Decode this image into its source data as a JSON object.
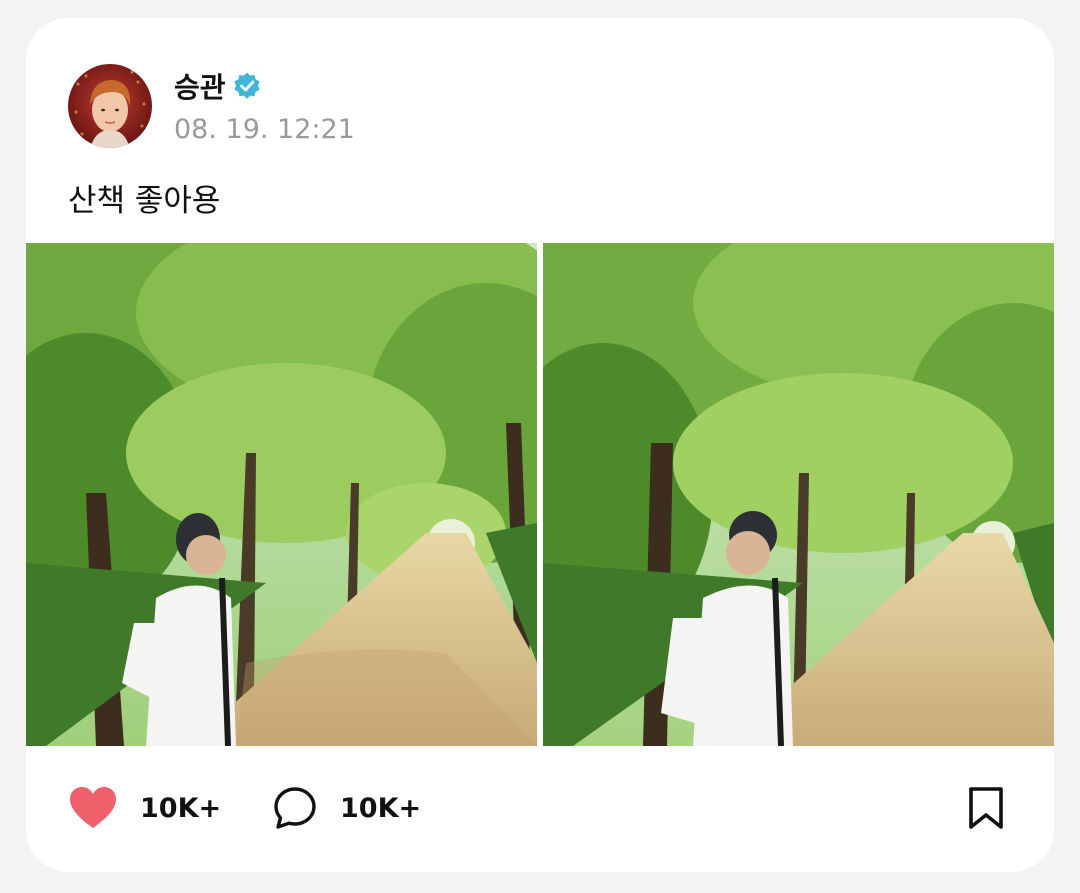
{
  "post": {
    "author": "승관",
    "verified": true,
    "timestamp": "08. 19. 12:21",
    "text": "산책 좋아용",
    "photos": [
      "walk-photo-1",
      "walk-photo-2"
    ]
  },
  "actions": {
    "likes": "10K+",
    "comments": "10K+"
  },
  "colors": {
    "like": "#f0606a",
    "verified": "#3fb6d8"
  }
}
